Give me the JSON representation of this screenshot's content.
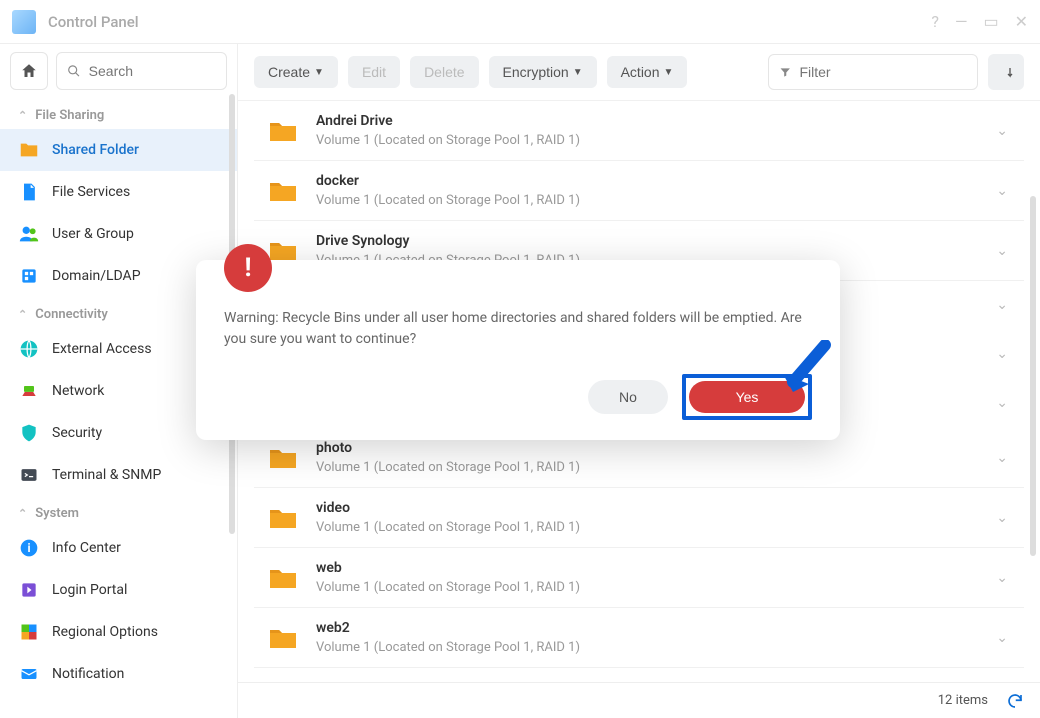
{
  "window": {
    "title": "Control Panel"
  },
  "sidebar": {
    "search_placeholder": "Search",
    "sections": [
      {
        "label": "File Sharing",
        "items": [
          {
            "id": "shared-folder",
            "label": "Shared Folder",
            "active": true,
            "icon": "folder"
          },
          {
            "id": "file-services",
            "label": "File Services",
            "icon": "file"
          },
          {
            "id": "user-group",
            "label": "User & Group",
            "icon": "users"
          },
          {
            "id": "domain-ldap",
            "label": "Domain/LDAP",
            "icon": "domain"
          }
        ]
      },
      {
        "label": "Connectivity",
        "items": [
          {
            "id": "external-access",
            "label": "External Access",
            "icon": "globe"
          },
          {
            "id": "network",
            "label": "Network",
            "icon": "network"
          },
          {
            "id": "security",
            "label": "Security",
            "icon": "shield"
          },
          {
            "id": "terminal-snmp",
            "label": "Terminal & SNMP",
            "icon": "terminal"
          }
        ]
      },
      {
        "label": "System",
        "items": [
          {
            "id": "info-center",
            "label": "Info Center",
            "icon": "info"
          },
          {
            "id": "login-portal",
            "label": "Login Portal",
            "icon": "portal"
          },
          {
            "id": "regional-options",
            "label": "Regional Options",
            "icon": "regional"
          },
          {
            "id": "notification",
            "label": "Notification",
            "icon": "notification"
          }
        ]
      }
    ]
  },
  "toolbar": {
    "create": "Create",
    "edit": "Edit",
    "delete": "Delete",
    "encryption": "Encryption",
    "action": "Action",
    "filter_placeholder": "Filter"
  },
  "folders": [
    {
      "name": "Andrei Drive",
      "location": "Volume 1 (Located on Storage Pool 1, RAID 1)"
    },
    {
      "name": "docker",
      "location": "Volume 1 (Located on Storage Pool 1, RAID 1)"
    },
    {
      "name": "Drive Synology",
      "location": "Volume 1 (Located on Storage Pool 1, RAID 1)"
    },
    {
      "name": "",
      "location": ""
    },
    {
      "name": "",
      "location": ""
    },
    {
      "name": "",
      "location": ""
    },
    {
      "name": "photo",
      "location": "Volume 1 (Located on Storage Pool 1, RAID 1)"
    },
    {
      "name": "video",
      "location": "Volume 1 (Located on Storage Pool 1, RAID 1)"
    },
    {
      "name": "web",
      "location": "Volume 1 (Located on Storage Pool 1, RAID 1)"
    },
    {
      "name": "web2",
      "location": "Volume 1 (Located on Storage Pool 1, RAID 1)"
    }
  ],
  "status": {
    "count_label": "12 items"
  },
  "dialog": {
    "message": "Warning: Recycle Bins under all user home directories and shared folders will be emptied. Are you sure you want to continue?",
    "no": "No",
    "yes": "Yes"
  }
}
